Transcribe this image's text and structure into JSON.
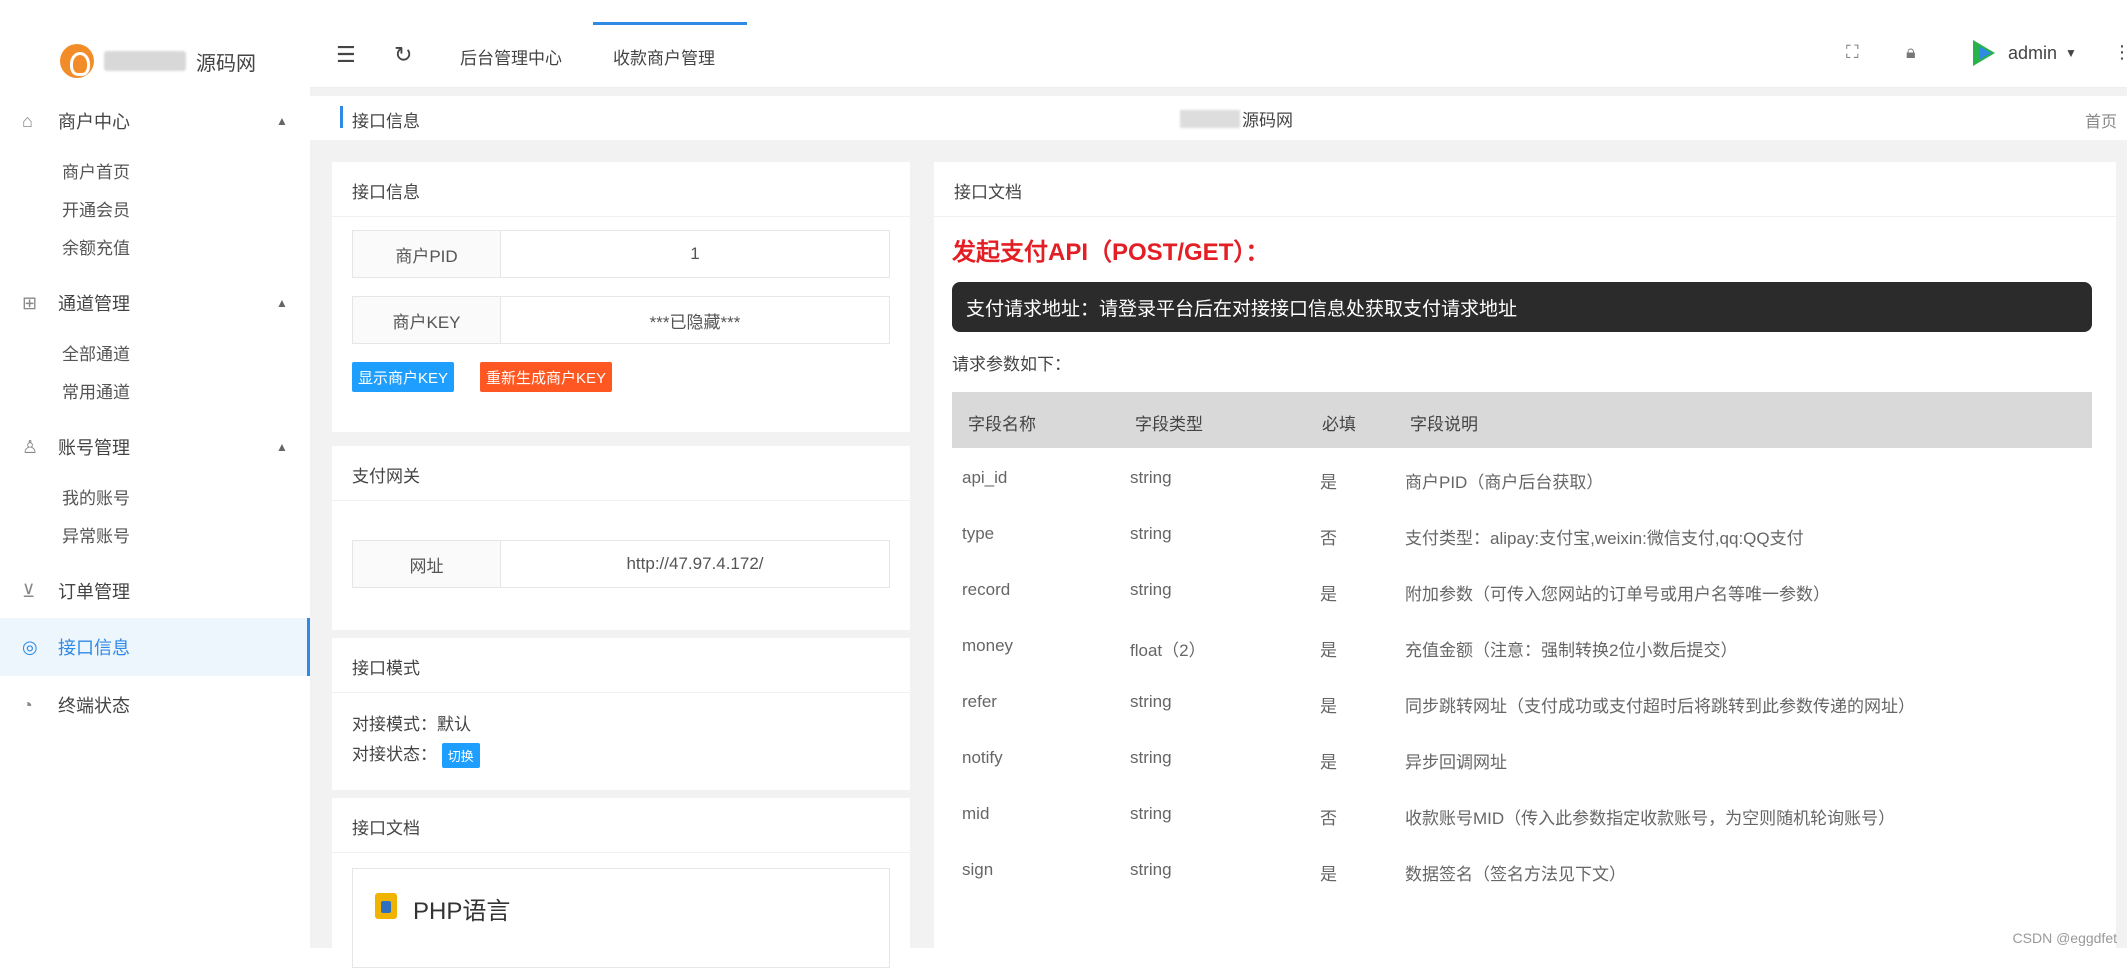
{
  "brand": {
    "name": "源码网"
  },
  "sidebar": {
    "groups": [
      {
        "label": "商户中心",
        "items": [
          "商户首页",
          "开通会员",
          "余额充值"
        ]
      },
      {
        "label": "通道管理",
        "items": [
          "全部通道",
          "常用通道"
        ]
      },
      {
        "label": "账号管理",
        "items": [
          "我的账号",
          "异常账号"
        ]
      }
    ],
    "orders": "订单管理",
    "api_info": "接口信息",
    "last": "终端状态"
  },
  "topbar": {
    "tabs": [
      "后台管理中心",
      "收款商户管理"
    ],
    "user": "admin"
  },
  "breadcrumb": {
    "label": "接口信息",
    "center": "源码网",
    "home": "首页"
  },
  "left": {
    "info_card": {
      "title": "接口信息",
      "rows": [
        {
          "key": "商户PID",
          "value": "1"
        },
        {
          "key": "商户KEY",
          "value": "***已隐藏***"
        }
      ],
      "show_key_btn": "显示商户KEY",
      "regen_key_btn": "重新生成商户KEY"
    },
    "gateway_card": {
      "title": "支付网关",
      "key": "网址",
      "value": "http://47.97.4.172/"
    },
    "mode_card": {
      "title": "接口模式",
      "mode_line": "对接模式：默认",
      "status_label": "对接状态：",
      "switch_btn": "切换"
    },
    "doc_card": {
      "title": "接口文档",
      "php": "PHP语言"
    }
  },
  "doc": {
    "title": "接口文档",
    "heading": "发起支付API（POST/GET）：",
    "url_text": "支付请求地址：请登录平台后在对接接口信息处获取支付请求地址",
    "params_label": "请求参数如下：",
    "columns": [
      "字段名称",
      "字段类型",
      "必填",
      "字段说明"
    ],
    "rows": [
      [
        "api_id",
        "string",
        "是",
        "商户PID（商户后台获取）"
      ],
      [
        "type",
        "string",
        "否",
        "支付类型：alipay:支付宝,weixin:微信支付,qq:QQ支付"
      ],
      [
        "record",
        "string",
        "是",
        "附加参数（可传入您网站的订单号或用户名等唯一参数）"
      ],
      [
        "money",
        "float（2）",
        "是",
        "充值金额（注意：强制转换2位小数后提交）"
      ],
      [
        "refer",
        "string",
        "是",
        "同步跳转网址（支付成功或支付超时后将跳转到此参数传递的网址）"
      ],
      [
        "notify",
        "string",
        "是",
        "异步回调网址"
      ],
      [
        "mid",
        "string",
        "否",
        "收款账号MID（传入此参数指定收款账号，为空则随机轮询账号）"
      ],
      [
        "sign",
        "string",
        "是",
        "数据签名（签名方法见下文）"
      ]
    ]
  },
  "watermark": "CSDN @eggdfet",
  "icons": {
    "menu": "hamburger-icon",
    "refresh": "refresh-icon",
    "fullscreen": "fullscreen-icon",
    "lock": "lock-icon",
    "more": "more-vertical-icon"
  }
}
